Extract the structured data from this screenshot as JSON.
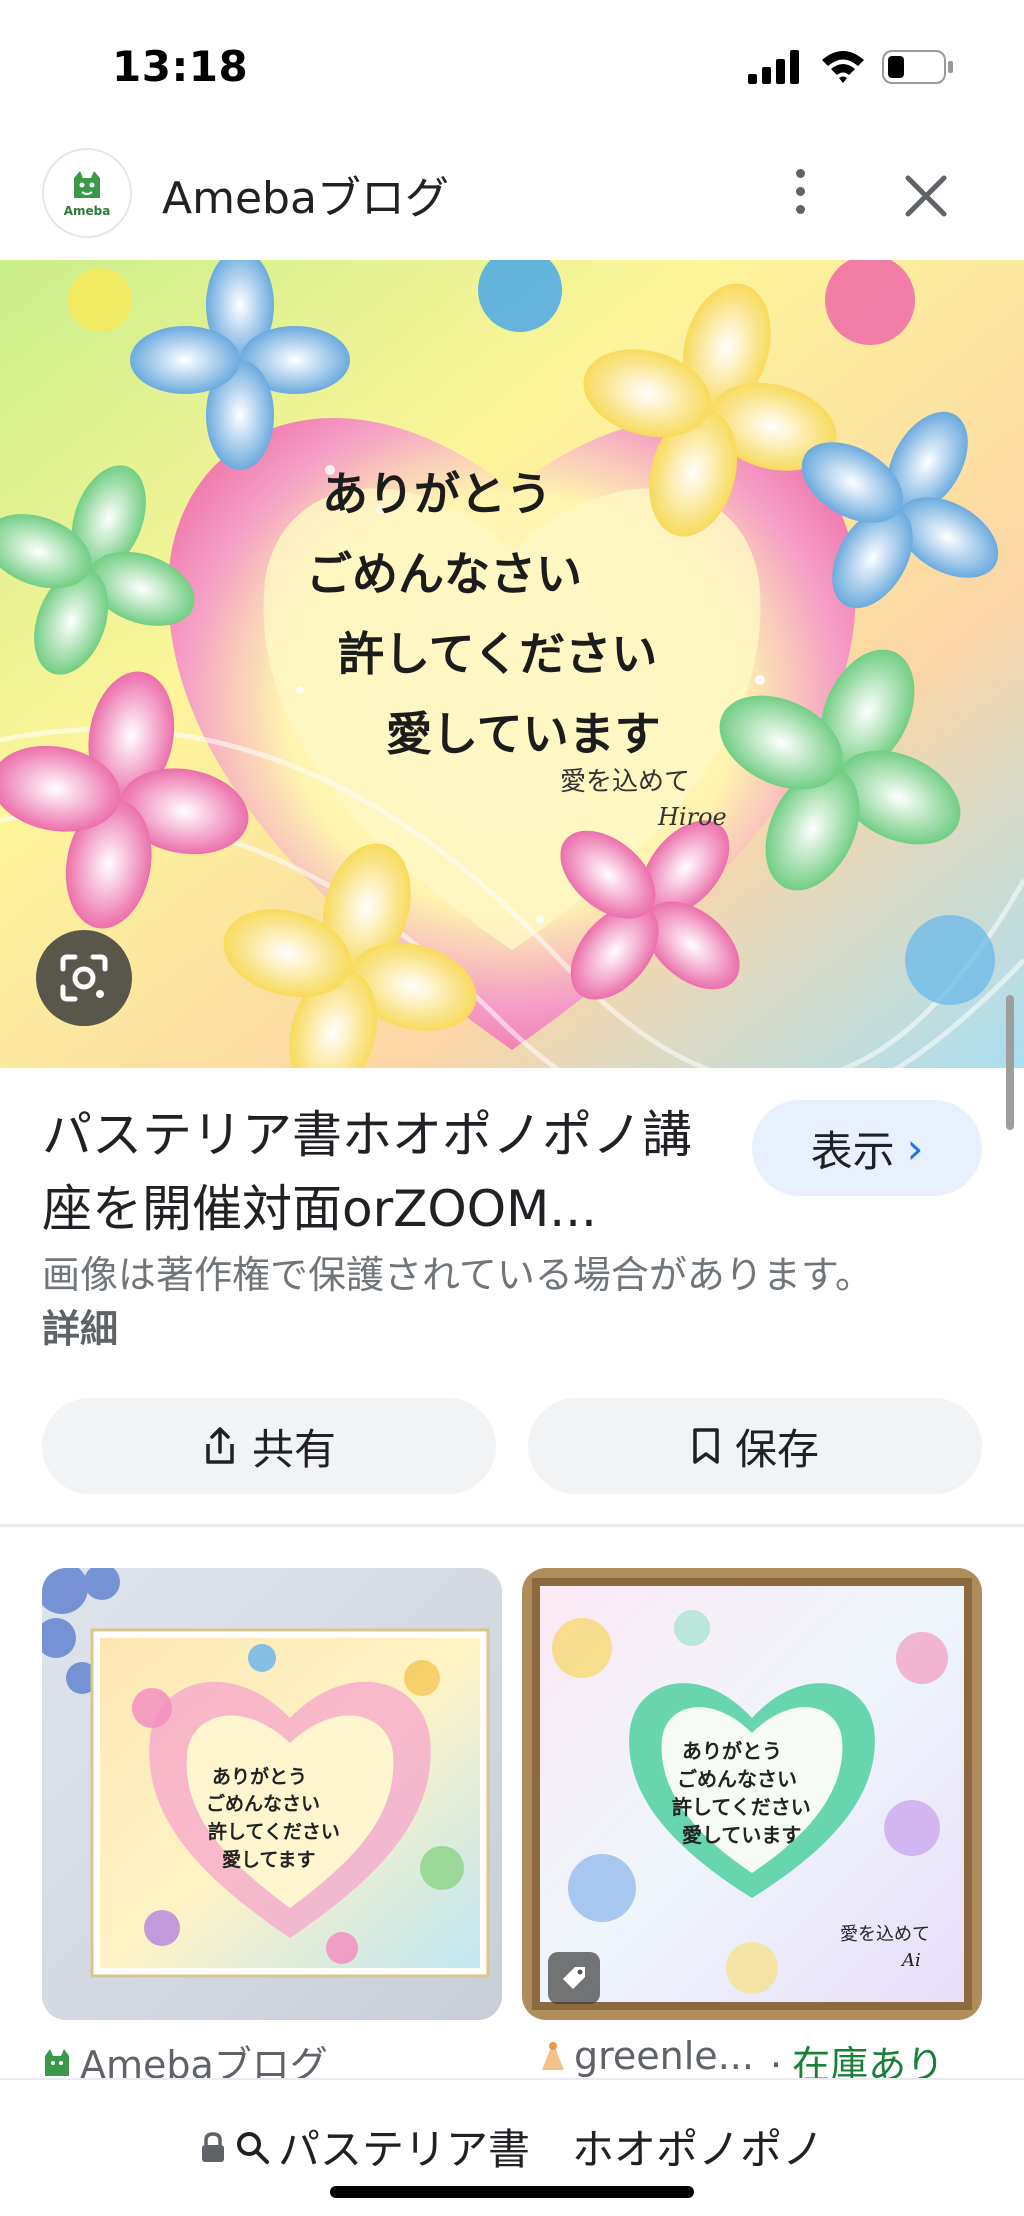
{
  "status_bar": {
    "time": "13:18"
  },
  "header": {
    "site_name": "Amebaブログ",
    "logo_text": "Ameba",
    "icons": [
      "ameba-logo-icon",
      "more-vert-icon",
      "close-icon"
    ]
  },
  "hero_image": {
    "artwork_lines": [
      "ありがとう",
      "ごめんなさい",
      "許してください",
      "愛しています"
    ],
    "signature_line1": "愛を込めて",
    "signature_line2": "Hiroe",
    "lens_icon": "google-lens-icon"
  },
  "result": {
    "title": "パステリア書ホオポノポノ講座を開催対面orZOOM...",
    "view_button_label": "表示",
    "view_chevron": "›",
    "copyright_notice": "画像は著作権で保護されている場合があります。",
    "detail_link": "詳細"
  },
  "actions": {
    "share_label": "共有",
    "save_label": "保存"
  },
  "related": [
    {
      "source": "Amebaブログ",
      "source_icon": "ameba-icon",
      "artwork_lines": [
        "ありがとう",
        "ごめんなさい",
        "許してください",
        "愛してます"
      ]
    },
    {
      "source": "greenle...",
      "source_icon": "shop-icon",
      "stock_status": "在庫あり",
      "artwork_lines": [
        "ありがとう",
        "ごめんなさい",
        "許してください",
        "愛しています"
      ],
      "signature_line1": "愛を込めて",
      "signature_line2": "Ai"
    }
  ],
  "bottom_bar": {
    "address": "パステリア書　ホオポノポノ"
  },
  "colors": {
    "accent_blue": "#1a73e8",
    "view_button_bg": "#e8f0fe",
    "stock_green": "#188038",
    "chip_bg": "#f1f3f4"
  }
}
